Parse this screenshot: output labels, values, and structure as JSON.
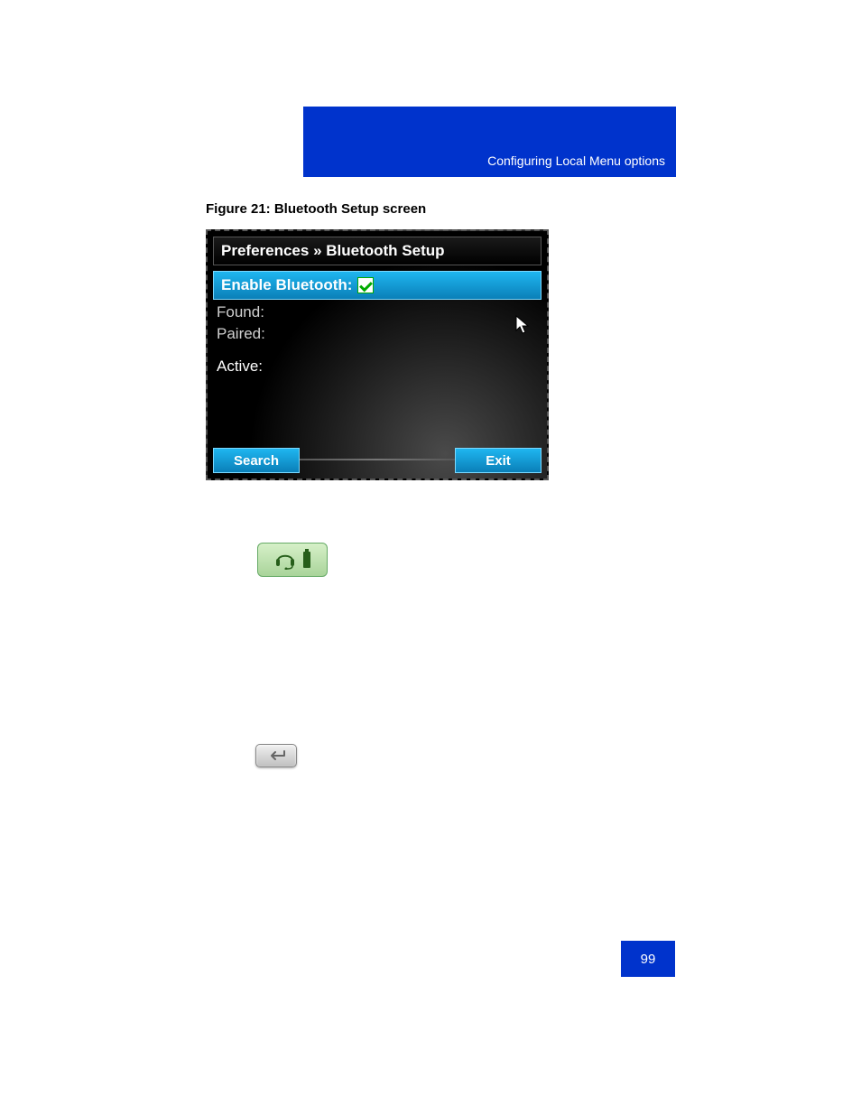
{
  "header": {
    "title": "Configuring Local Menu options"
  },
  "figure": {
    "caption": "Figure 21: Bluetooth Setup screen"
  },
  "phone_screen": {
    "breadcrumb": "Preferences » Bluetooth Setup",
    "enable_label": "Enable Bluetooth:",
    "enable_checked": true,
    "found_label": "Found:",
    "paired_label": "Paired:",
    "active_label": "Active:",
    "softkey_left": "Search",
    "softkey_right": "Exit"
  },
  "page_number": "99"
}
